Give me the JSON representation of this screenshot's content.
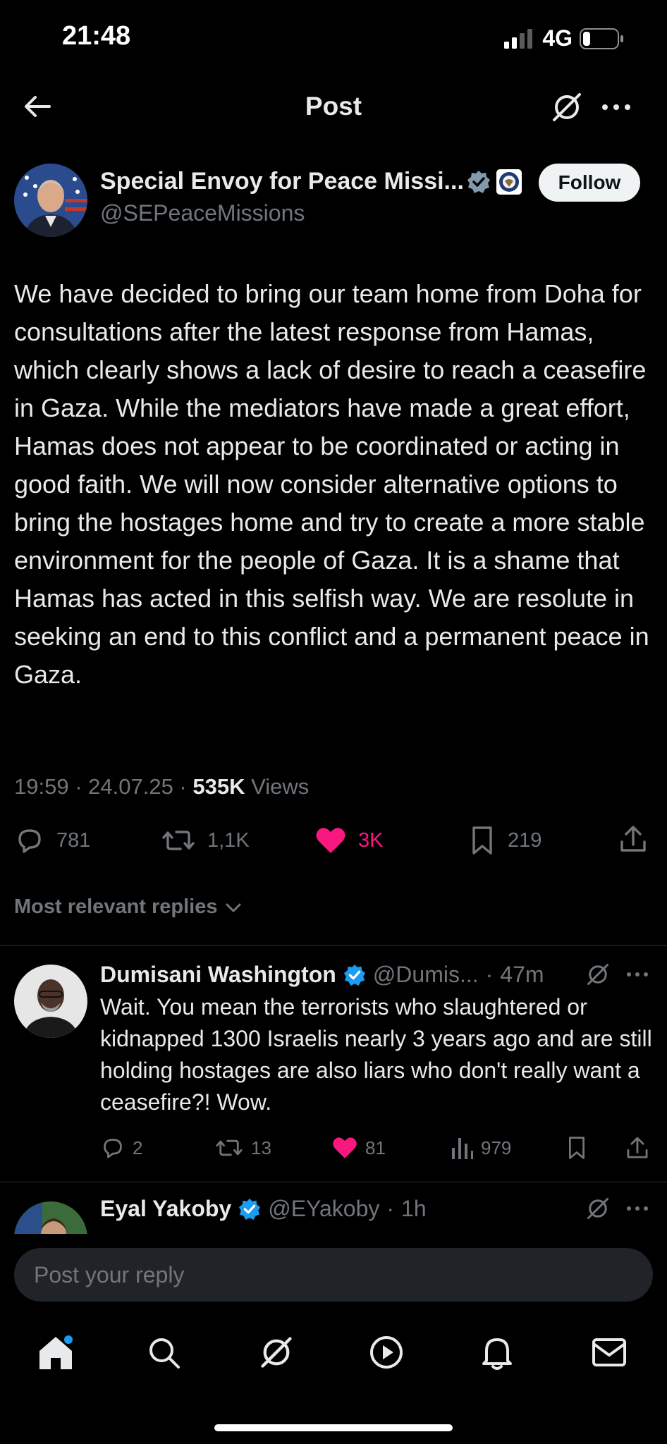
{
  "status_bar": {
    "time": "21:48",
    "network": "4G"
  },
  "header": {
    "title": "Post"
  },
  "post": {
    "author_name": "Special Envoy for Peace Missi...",
    "author_handle": "@SEPeaceMissions",
    "follow_label": "Follow",
    "text": "We have decided to bring our team home from Doha for consultations after the latest response from Hamas, which clearly shows a lack of desire to reach a ceasefire in Gaza. While the mediators have made a great effort, Hamas does not appear to be coordinated or acting in good faith. We will now consider alternative options to bring the hostages home and try to create a more stable environment for the people of Gaza. It is a shame that Hamas has acted in this selfish way. We are resolute in seeking an end to this conflict and a permanent peace in Gaza.",
    "time": "19:59",
    "date": "24.07.25",
    "views_count": "535K",
    "views_label": "Views",
    "replies": "781",
    "reposts": "1,1K",
    "likes": "3K",
    "bookmarks": "219"
  },
  "replies_filter": "Most relevant replies",
  "replies": [
    {
      "name": "Dumisani Washington",
      "handle": "@Dumis...",
      "time": "47m",
      "text": "Wait. You mean the terrorists who slaughtered or kidnapped 1300 Israelis nearly 3 years ago and are still holding hostages are also liars who don't really want a ceasefire?! Wow.",
      "replies": "2",
      "reposts": "13",
      "likes": "81",
      "views": "979"
    },
    {
      "name": "Eyal Yakoby",
      "handle": "@EYakoby",
      "time": "1h"
    }
  ],
  "reply_input": {
    "placeholder": "Post your reply"
  },
  "colors": {
    "like": "#f91880",
    "verified": "#1d9bf0",
    "text": "#e7e9ea",
    "muted": "#71767b"
  }
}
